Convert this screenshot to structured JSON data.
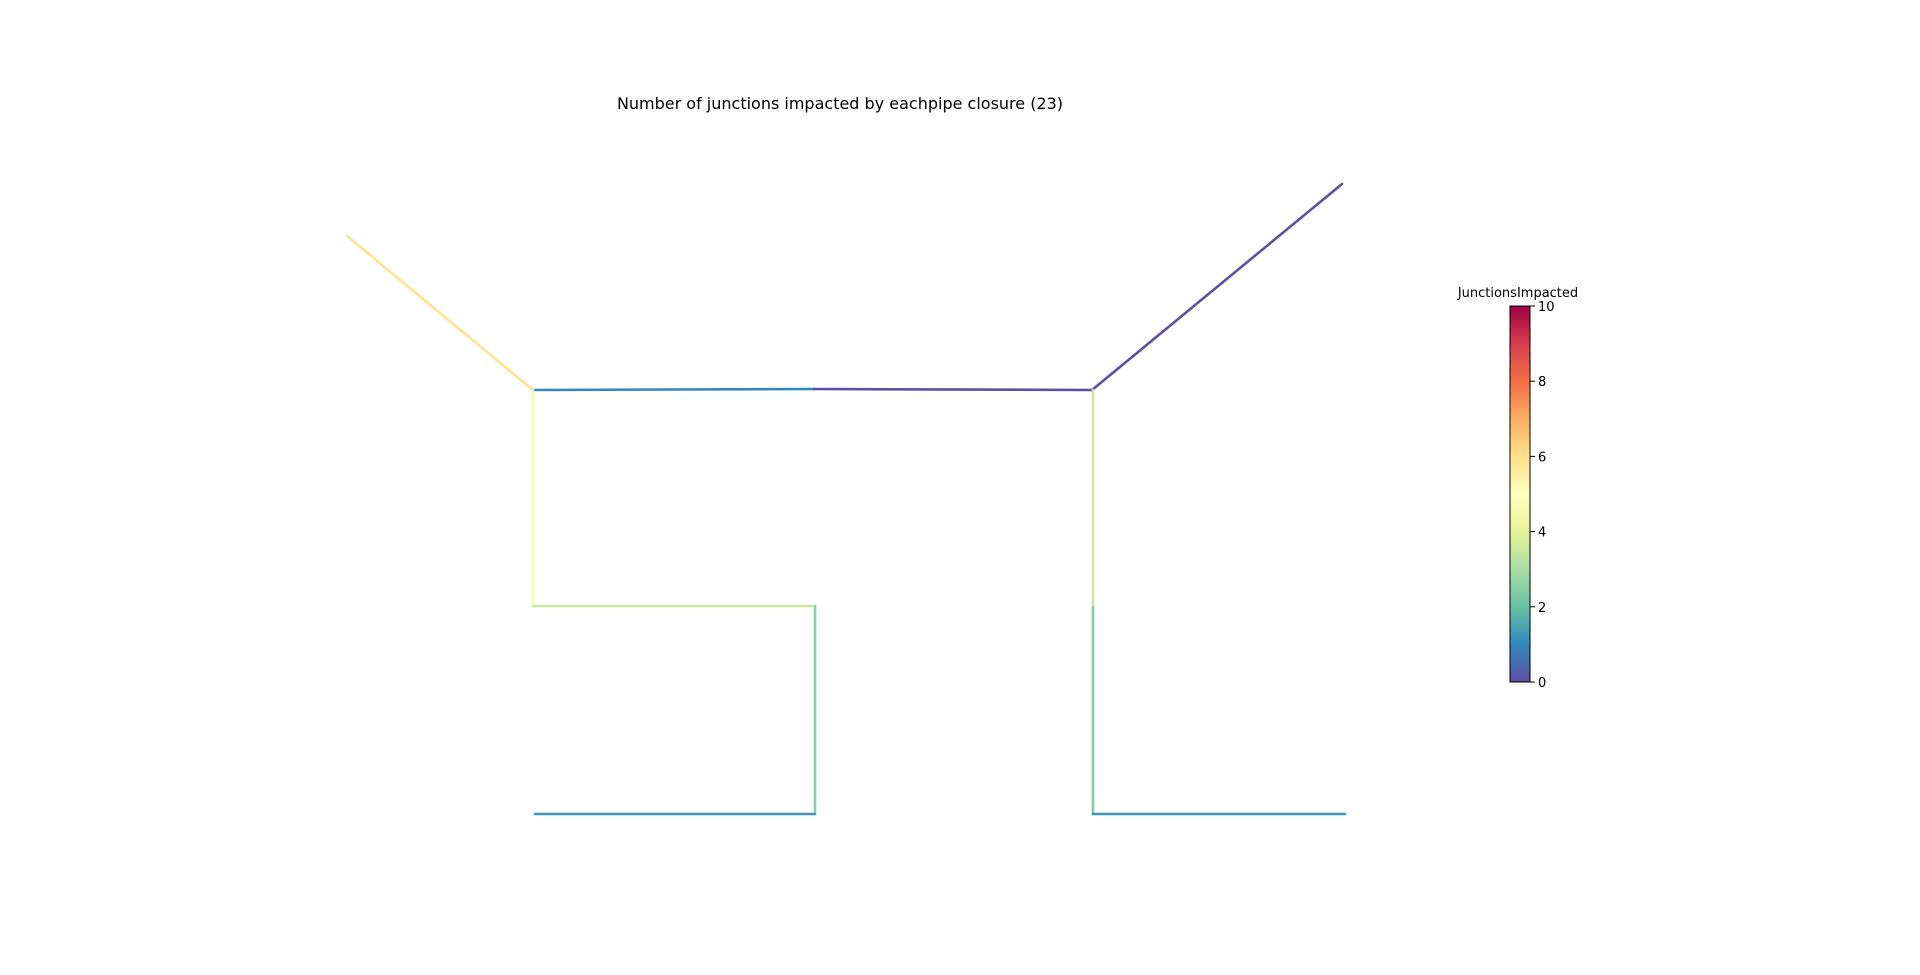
{
  "title": "Number of junctions impacted by eachpipe closure (23)",
  "colorbar": {
    "label": "JunctionsImpacted",
    "min": 0,
    "max": 10,
    "ticks": [
      "0",
      "2",
      "4",
      "6",
      "8",
      "10"
    ],
    "colormap": "Spectral_r",
    "stops": [
      "#5e4fa2",
      "#3288bd",
      "#66c2a5",
      "#abdda4",
      "#e6f598",
      "#ffffbf",
      "#fee08b",
      "#fdae61",
      "#f46d43",
      "#d53e4f",
      "#9e0142"
    ]
  },
  "network": {
    "pipes": [
      {
        "id": "p1",
        "value": 5.9
      },
      {
        "id": "p2",
        "value": 1.0
      },
      {
        "id": "p3",
        "value": 0.0
      },
      {
        "id": "p4",
        "value": 0.0
      },
      {
        "id": "p5",
        "value": 4.6
      },
      {
        "id": "p6",
        "value": 3.5
      },
      {
        "id": "p7",
        "value": 2.5
      },
      {
        "id": "p8",
        "value": 1.2
      },
      {
        "id": "p9",
        "value": 3.5
      },
      {
        "id": "p10",
        "value": 2.4
      },
      {
        "id": "p11",
        "value": 1.2
      }
    ]
  }
}
